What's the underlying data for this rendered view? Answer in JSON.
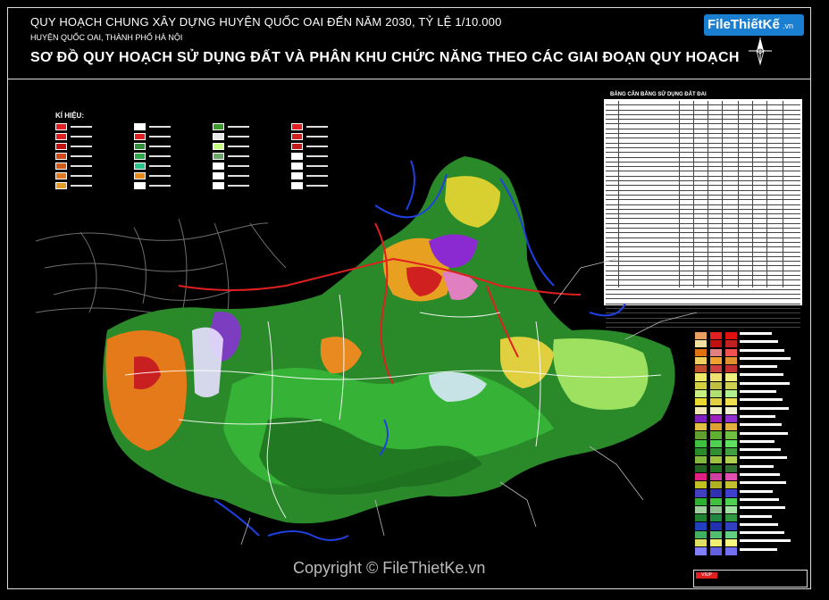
{
  "title": {
    "line1": "QUY HOẠCH CHUNG XÂY DỰNG HUYỆN QUỐC OAI ĐẾN NĂM 2030, TỶ LỆ 1/10.000",
    "line2": "HUYỆN QUỐC OAI, THÀNH PHỐ HÀ NỘI",
    "line3": "SƠ ĐỒ QUY HOẠCH SỬ DỤNG ĐẤT VÀ PHÂN KHU CHỨC NĂNG THEO CÁC GIAI ĐOẠN QUY HOẠCH"
  },
  "logo": {
    "text": "FileThiếtKế",
    "suffix": ".vn"
  },
  "legend": {
    "heading": "KÍ HIỆU:",
    "items": [
      {
        "color": "#e02020"
      },
      {
        "color": "#e02020"
      },
      {
        "color": "#c01010"
      },
      {
        "color": "#d24a1a"
      },
      {
        "color": "#d05a18"
      },
      {
        "color": "#e07a20"
      },
      {
        "color": "#e69a28"
      },
      {
        "color": "#ffffff"
      },
      {
        "color": "#e02020"
      },
      {
        "color": "#2f8f3a"
      },
      {
        "color": "#2fa84a"
      },
      {
        "color": "#29c48a"
      },
      {
        "color": "#e88a18"
      },
      {
        "color": "#ffffff"
      },
      {
        "color": "#3d9a2a"
      },
      {
        "color": "#e7e7e7"
      },
      {
        "color": "#c7ff80"
      },
      {
        "color": "#6aa86a"
      },
      {
        "color": "#ffffff"
      },
      {
        "color": "#ffffff"
      },
      {
        "color": "#ffffff"
      },
      {
        "color": "#e02020"
      },
      {
        "color": "#d02020"
      },
      {
        "color": "#c01a1a"
      },
      {
        "color": "#ffffff"
      },
      {
        "color": "#ffffff"
      },
      {
        "color": "#ffffff"
      },
      {
        "color": "#ffffff"
      }
    ]
  },
  "table": {
    "title": "BẢNG CÂN BẰNG SỬ DỤNG ĐẤT ĐAI"
  },
  "swatches": {
    "col1": [
      "#e8a060",
      "#f0e0a0",
      "#e07010",
      "#f0d060",
      "#c05030",
      "#f0e868",
      "#d0d040",
      "#c8f080",
      "#e8d830",
      "#f0e8b0",
      "#8020c0",
      "#e0c040",
      "#60a030",
      "#40c040",
      "#2a8a2a",
      "#80b840",
      "#206020",
      "#e02080",
      "#c0c020",
      "#4040c0",
      "#30b030",
      "#a0d0a0",
      "#208030",
      "#2040c0",
      "#40b060",
      "#e0e060",
      "#8080ff"
    ],
    "col2": [
      "#e02020",
      "#c01010",
      "#e08080",
      "#f0a030",
      "#d04040",
      "#f0e070",
      "#c0c040",
      "#b0e070",
      "#e0d040",
      "#f0f0c0",
      "#a020c0",
      "#e0a030",
      "#60b030",
      "#50d050",
      "#309030",
      "#a0c040",
      "#207020",
      "#d040a0",
      "#b0b020",
      "#3030b0",
      "#40c040",
      "#90c090",
      "#208840",
      "#2030b0",
      "#50c070",
      "#f0f070",
      "#6060e0"
    ],
    "col3": [
      "#e01010",
      "#c02020",
      "#f05050",
      "#e09030",
      "#c03030",
      "#f0f080",
      "#d0d050",
      "#b0f090",
      "#f0e050",
      "#f0f0d0",
      "#9030d0",
      "#e0b040",
      "#70c040",
      "#60e060",
      "#40a040",
      "#b0d050",
      "#307030",
      "#e050b0",
      "#c0c030",
      "#4040d0",
      "#50d050",
      "#a0e0a0",
      "#309840",
      "#3040c0",
      "#60d080",
      "#f8f880",
      "#7070f0"
    ]
  },
  "copyright": "Copyright © FileThietKe.vn",
  "title_block": {
    "brand": "VIUP"
  }
}
